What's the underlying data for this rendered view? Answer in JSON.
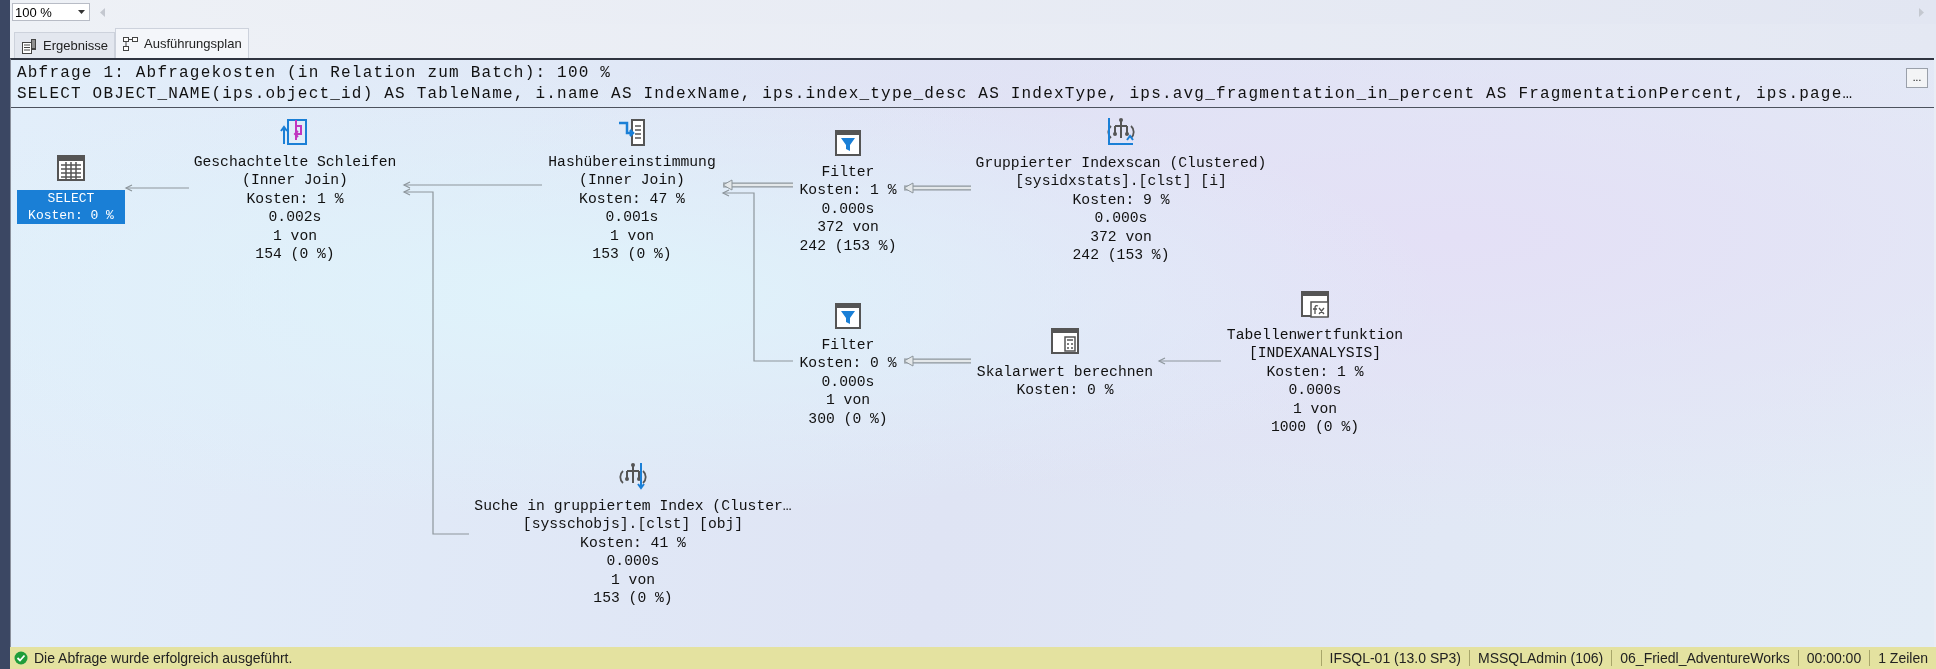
{
  "toolbar": {
    "zoom": "100 %"
  },
  "tabs": [
    {
      "label": "Ergebnisse",
      "kind": "results",
      "selected": false
    },
    {
      "label": "Ausführungsplan",
      "kind": "plan",
      "selected": true
    }
  ],
  "query_header": {
    "cost_line": "Abfrage 1: Abfragekosten (in Relation zum Batch): 100 %",
    "sql": "SELECT OBJECT_NAME(ips.object_id) AS TableName, i.name AS IndexName, ips.index_type_desc AS IndexType, ips.avg_fragmentation_in_percent AS FragmentationPercent, ips.page…",
    "more_button": "..."
  },
  "plan_nodes": [
    {
      "kind": "select",
      "selected": true,
      "lines": [
        "SELECT",
        "Kosten: 0 %"
      ]
    },
    {
      "kind": "nested_loops",
      "selected": false,
      "lines": [
        "Geschachtelte Schleifen",
        "(Inner Join)",
        "Kosten: 1 %",
        "0.002s",
        "1 von",
        "154 (0 %)"
      ]
    },
    {
      "kind": "hash_match",
      "selected": false,
      "lines": [
        "Hashübereinstimmung",
        "(Inner Join)",
        "Kosten: 47 %",
        "0.001s",
        "1 von",
        "153 (0 %)"
      ]
    },
    {
      "kind": "filter",
      "selected": false,
      "lines": [
        "Filter",
        "Kosten: 1 %",
        "0.000s",
        "372 von",
        "242 (153 %)"
      ]
    },
    {
      "kind": "index_scan",
      "selected": false,
      "lines": [
        "Gruppierter Indexscan (Clustered)",
        "[sysidxstats].[clst] [i]",
        "Kosten: 9 %",
        "0.000s",
        "372 von",
        "242 (153 %)"
      ]
    },
    {
      "kind": "filter",
      "selected": false,
      "lines": [
        "Filter",
        "Kosten: 0 %",
        "0.000s",
        "1 von",
        "300 (0 %)"
      ]
    },
    {
      "kind": "compute_scalar",
      "selected": false,
      "lines": [
        "Skalarwert berechnen",
        "Kosten: 0 %"
      ]
    },
    {
      "kind": "table_function",
      "selected": false,
      "lines": [
        "Tabellenwertfunktion",
        "[INDEXANALYSIS]",
        "Kosten: 1 %",
        "0.000s",
        "1 von",
        "1000 (0 %)"
      ]
    },
    {
      "kind": "index_seek",
      "selected": false,
      "lines": [
        "Suche in gruppiertem Index (Cluster…",
        "[sysschobjs].[clst] [obj]",
        "Kosten: 41 %",
        "0.000s",
        "1 von",
        "153 (0 %)"
      ]
    }
  ],
  "status_bar": {
    "message": "Die Abfrage wurde erfolgreich ausgeführt.",
    "server": "IFSQL-01 (13.0 SP3)",
    "user": "MSSQLAdmin (106)",
    "database": "06_Friedl_AdventureWorks",
    "duration": "00:00:00",
    "rows": "1 Zeilen"
  }
}
